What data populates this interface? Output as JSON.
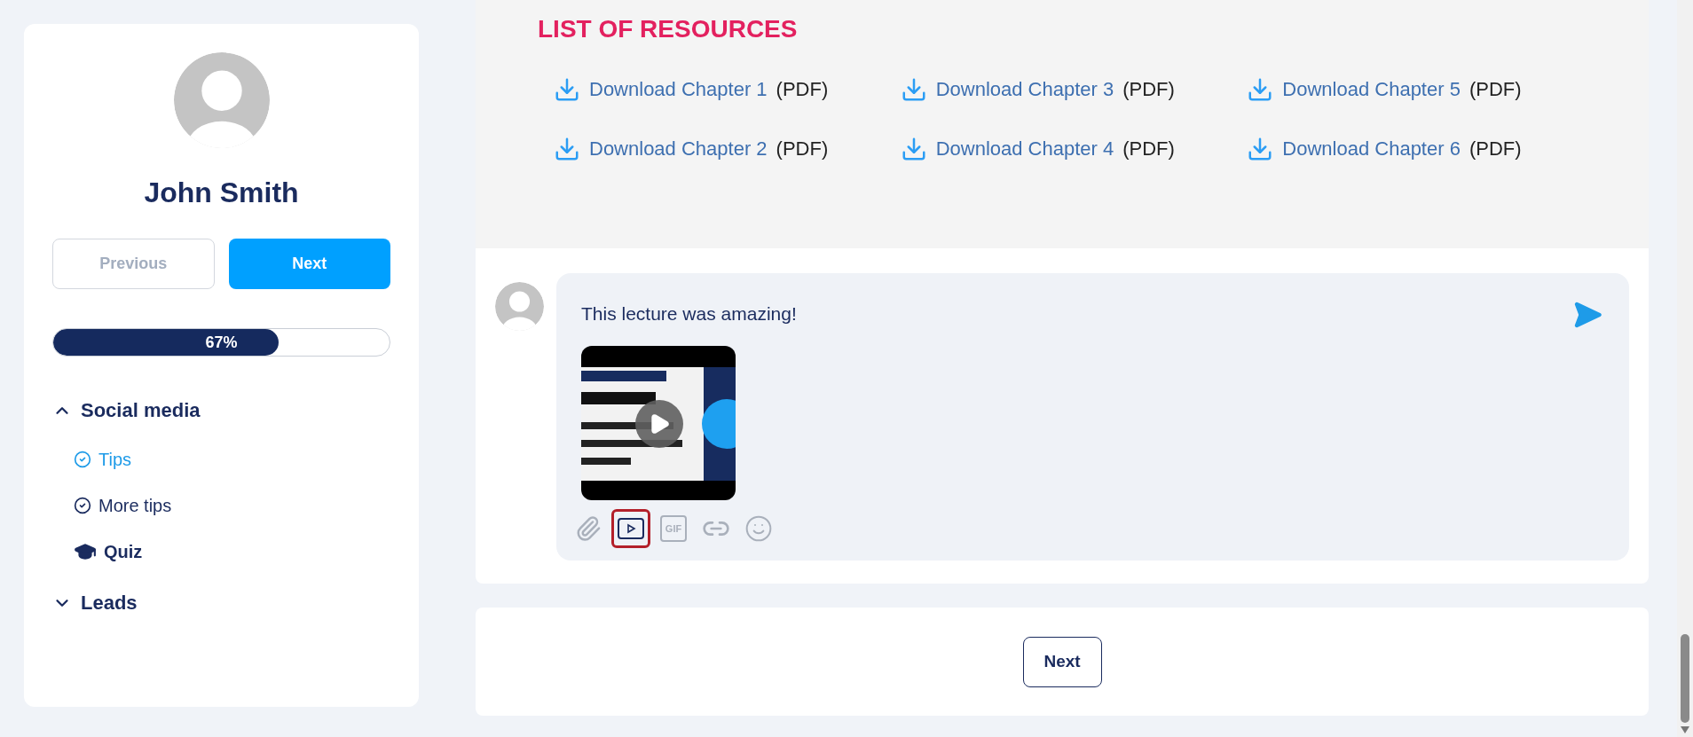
{
  "sidebar": {
    "user_name": "John Smith",
    "buttons": [
      {
        "label": "Previous",
        "disabled": true
      },
      {
        "label": "Next",
        "disabled": false
      }
    ],
    "progress": {
      "level": 0.67,
      "reading": "67%"
    },
    "sections": [
      {
        "label": "Social media",
        "expanded": true,
        "children": [
          {
            "label": "Tips",
            "kind": "lesson",
            "selected": true
          },
          {
            "label": "More tips",
            "kind": "lesson",
            "selected": false
          },
          {
            "label": "Quiz",
            "kind": "quiz",
            "selected": false
          }
        ]
      },
      {
        "label": "Leads",
        "expanded": false
      }
    ]
  },
  "resources": {
    "title": "LIST OF RESOURCES",
    "links": [
      {
        "link": "Download Chapter 1",
        "suffix": "(PDF)"
      },
      {
        "link": "Download Chapter 3",
        "suffix": "(PDF)"
      },
      {
        "link": "Download Chapter 5",
        "suffix": "(PDF)"
      },
      {
        "link": "Download Chapter 2",
        "suffix": "(PDF)"
      },
      {
        "link": "Download Chapter 4",
        "suffix": "(PDF)"
      },
      {
        "link": "Download Chapter 6",
        "suffix": "(PDF)"
      }
    ]
  },
  "comment": {
    "text": "This lecture was amazing!",
    "tools": [
      {
        "kind": "attach",
        "selected": false
      },
      {
        "kind": "video",
        "selected": true
      },
      {
        "kind": "gif",
        "label": "GIF",
        "selected": false
      },
      {
        "kind": "link",
        "selected": false
      },
      {
        "kind": "emoji",
        "selected": false
      }
    ]
  },
  "footer": {
    "button": "Next"
  }
}
